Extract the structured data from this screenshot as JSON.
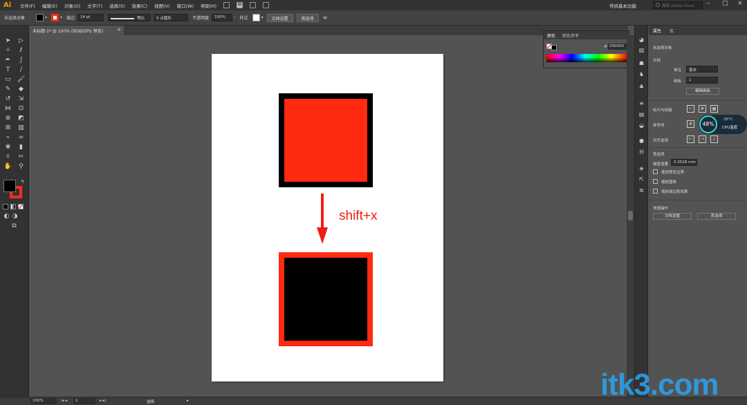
{
  "app": {
    "logo": "Ai"
  },
  "menubar": {
    "items": [
      "文件(F)",
      "编辑(E)",
      "对象(O)",
      "文字(T)",
      "选择(S)",
      "效果(C)",
      "视图(V)",
      "窗口(W)",
      "帮助(H)"
    ],
    "st_icon": "St",
    "workspace": "传统基本功能",
    "search_placeholder": "搜索 Adobe Stock"
  },
  "controlbar": {
    "selection_label": "未选择对象",
    "fill_color": "#000000",
    "stroke_color": "#ff2a10",
    "stroke_label": "描边",
    "stroke_width": "14 pt",
    "stroke_profile": "等比",
    "brush": "5 点圆形",
    "opacity_label": "不透明度",
    "opacity_value": "100%",
    "style_label": "样式",
    "doc_setup_button": "文档设置",
    "preferences_button": "首选项"
  },
  "document": {
    "tab_title": "未标题-1* @ 100% (RGB/GPU 预览)",
    "close_glyph": "×"
  },
  "artwork": {
    "shortcut_text": "shift+x",
    "accent_color": "#ee1e12"
  },
  "color_panel": {
    "tabs": [
      "颜色",
      "颜色参考"
    ],
    "hash": "#",
    "hex_value": "000000"
  },
  "properties_panel": {
    "tabs": [
      "属性",
      "库"
    ],
    "selection": "未选择对象",
    "document_label": "文档",
    "units_label": "单位",
    "units_value": "毫米",
    "artboard_label": "画板",
    "artboard_value": "1",
    "edit_artboards_button": "编辑画板",
    "rulers_grids_label": "标尺与网格",
    "guides_label": "参考线",
    "snap_label": "对齐选项",
    "preferences_label": "首选项",
    "keyboard_increment_label": "键盘增量",
    "keyboard_increment_value": "0.3528 mm",
    "checkbox_preview_bounds": "使用预览边界",
    "checkbox_scale_corners": "缩放圆角",
    "checkbox_scale_strokes": "缩放描边和效果",
    "quick_actions_label": "快速操作",
    "doc_setup_button": "文档设置",
    "preferences_button": "首选项"
  },
  "cpu_widget": {
    "percent": "48%",
    "temperature": "28°C",
    "label": "CPU温度"
  },
  "statusbar": {
    "zoom": "100%",
    "artboard": "1",
    "tool_status": "选择"
  },
  "watermark": {
    "text": "itk3.com"
  }
}
